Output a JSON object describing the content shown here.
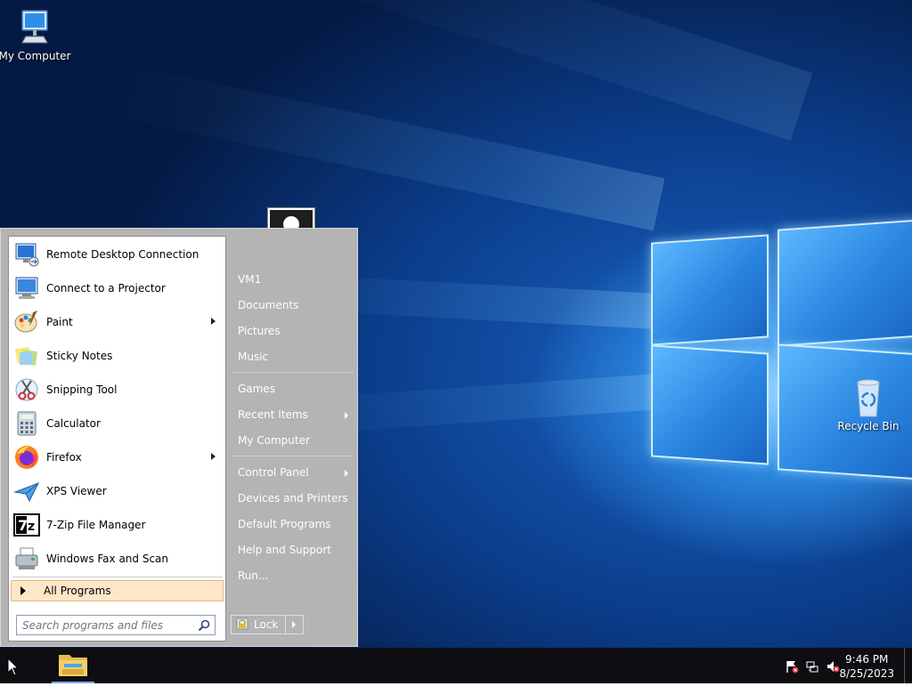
{
  "desktop": {
    "icons": [
      {
        "label": "My Computer",
        "icon": "monitor-icon"
      },
      {
        "label": "Recycle Bin",
        "icon": "recycle-bin-icon"
      }
    ]
  },
  "start_menu": {
    "programs": [
      {
        "label": "Remote Desktop Connection",
        "icon": "remote-desktop-icon",
        "submenu": false
      },
      {
        "label": "Connect to a Projector",
        "icon": "projector-icon",
        "submenu": false
      },
      {
        "label": "Paint",
        "icon": "paint-icon",
        "submenu": true
      },
      {
        "label": "Sticky Notes",
        "icon": "sticky-notes-icon",
        "submenu": false
      },
      {
        "label": "Snipping Tool",
        "icon": "snipping-tool-icon",
        "submenu": false
      },
      {
        "label": "Calculator",
        "icon": "calculator-icon",
        "submenu": false
      },
      {
        "label": "Firefox",
        "icon": "firefox-icon",
        "submenu": true
      },
      {
        "label": "XPS Viewer",
        "icon": "xps-viewer-icon",
        "submenu": false
      },
      {
        "label": "7-Zip File Manager",
        "icon": "seven-zip-icon",
        "submenu": false
      },
      {
        "label": "Windows Fax and Scan",
        "icon": "fax-icon",
        "submenu": false
      }
    ],
    "all_programs": "All Programs",
    "search_placeholder": "Search programs and files",
    "right_items": [
      {
        "label": "VM1"
      },
      {
        "label": "Documents"
      },
      {
        "label": "Pictures"
      },
      {
        "label": "Music"
      },
      {
        "label": "Games"
      },
      {
        "label": "Recent Items",
        "submenu": true
      },
      {
        "label": "My Computer"
      },
      {
        "label": "Control Panel",
        "submenu": true
      },
      {
        "label": "Devices and Printers"
      },
      {
        "label": "Default Programs"
      },
      {
        "label": "Help and Support"
      },
      {
        "label": "Run..."
      }
    ],
    "lock_label": "Lock"
  },
  "taskbar": {
    "time": "9:46 PM",
    "date": "8/25/2023",
    "tray_icons": [
      "action-center-flag-icon",
      "network-icon",
      "volume-muted-icon"
    ]
  }
}
